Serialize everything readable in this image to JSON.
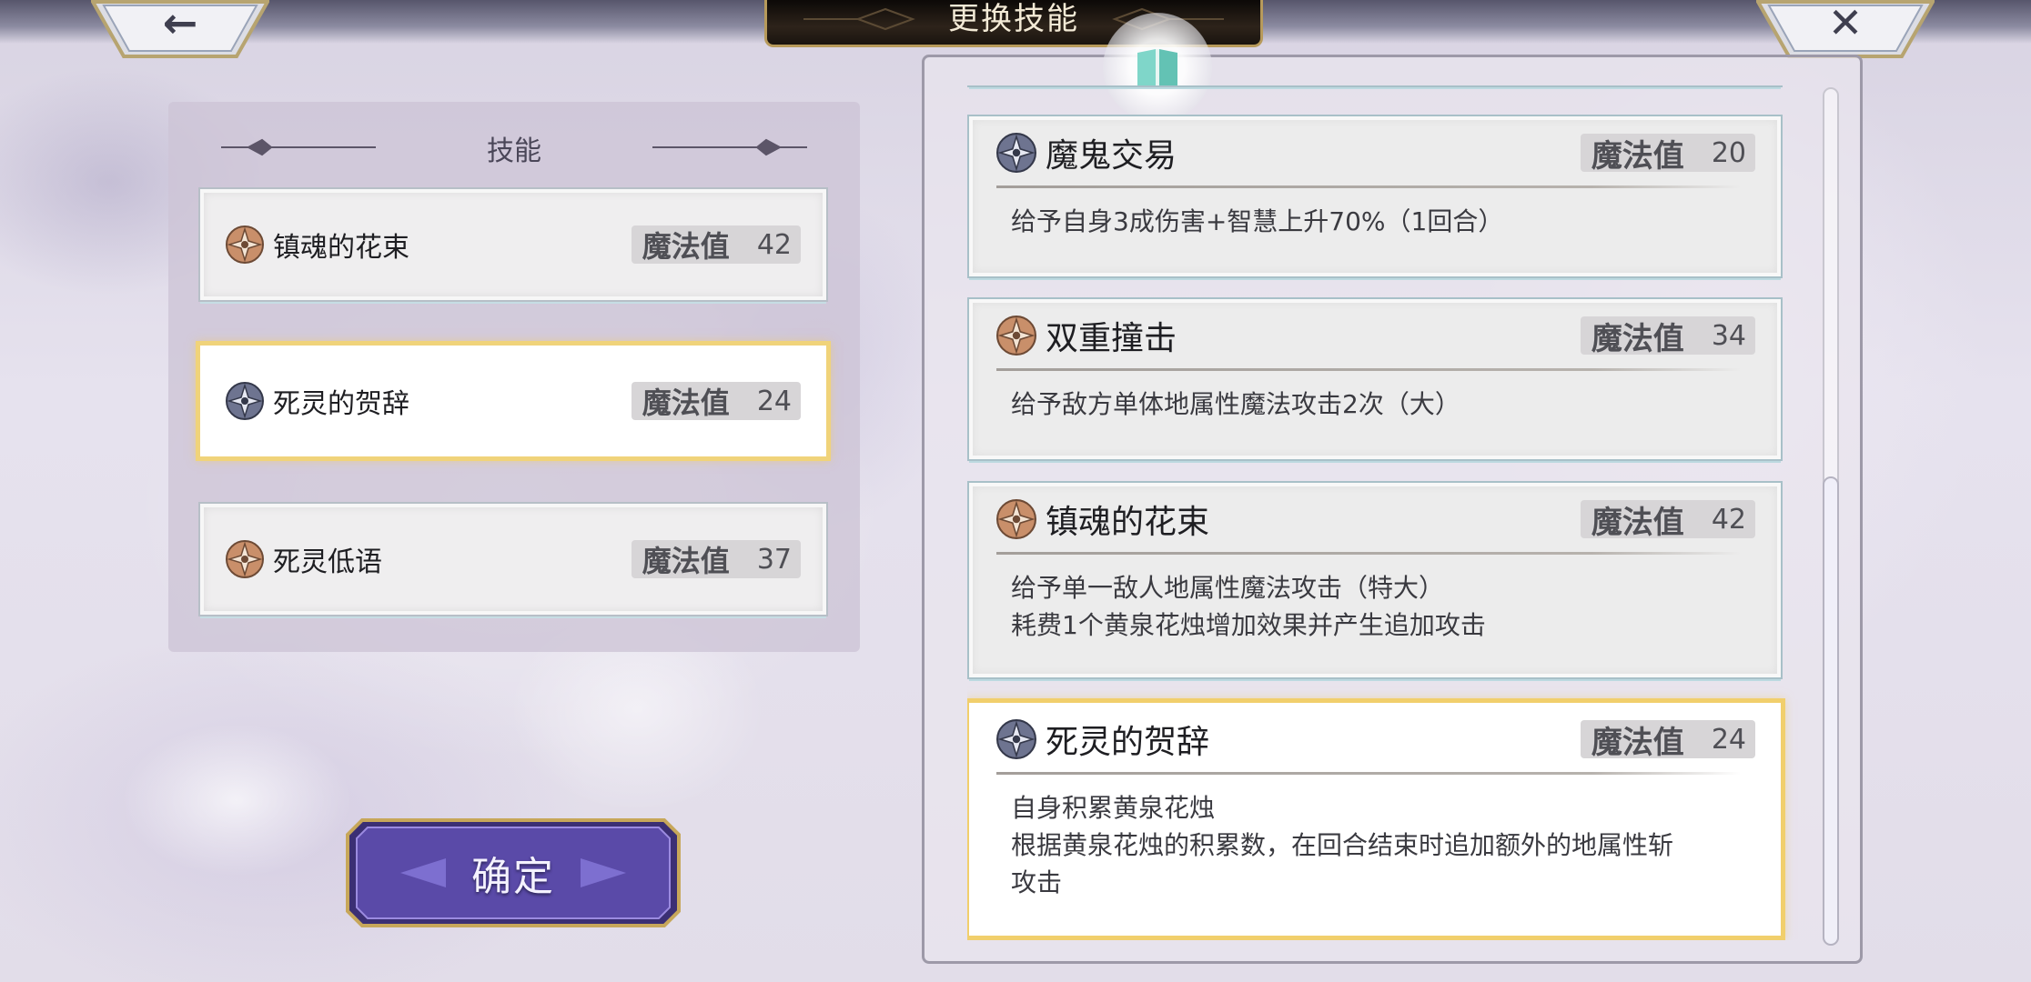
{
  "screen": {
    "title": "更换技能"
  },
  "nav": {
    "back_glyph": "←",
    "close_glyph": "✕"
  },
  "left_panel": {
    "header": "技能",
    "slots": [
      {
        "name": "镇魂的花束",
        "mp_label": "魔法值",
        "mp": "42",
        "icon": "earth-element-icon",
        "selected": false
      },
      {
        "name": "死灵的贺辞",
        "mp_label": "魔法值",
        "mp": "24",
        "icon": "dark-element-icon",
        "selected": true
      },
      {
        "name": "死灵低语",
        "mp_label": "魔法值",
        "mp": "37",
        "icon": "earth-element-icon",
        "selected": false
      }
    ]
  },
  "confirm": {
    "label": "确定"
  },
  "skill_list": [
    {
      "name": "魔鬼交易",
      "mp_label": "魔法值",
      "mp": "20",
      "icon": "dark-element-icon",
      "desc": [
        "给予自身3成伤害+智慧上升70%（1回合）"
      ],
      "selected": false
    },
    {
      "name": "双重撞击",
      "mp_label": "魔法值",
      "mp": "34",
      "icon": "earth-element-icon",
      "desc": [
        "给予敌方单体地属性魔法攻击2次（大）"
      ],
      "selected": false
    },
    {
      "name": "镇魂的花束",
      "mp_label": "魔法值",
      "mp": "42",
      "icon": "earth-element-icon",
      "desc": [
        "给予单一敌人地属性魔法攻击（特大）",
        "耗费1个黄泉花烛增加效果并产生追加攻击"
      ],
      "selected": false
    },
    {
      "name": "死灵的贺辞",
      "mp_label": "魔法值",
      "mp": "24",
      "icon": "dark-element-icon",
      "desc": [
        "自身积累黄泉花烛",
        "根据黄泉花烛的积累数，在回合结束时追加额外的地属性斩",
        "攻击"
      ],
      "selected": true
    }
  ],
  "colors": {
    "selected_border": "#f0d37a",
    "earth_icon": "#c98f6a",
    "dark_icon": "#6e7490"
  }
}
